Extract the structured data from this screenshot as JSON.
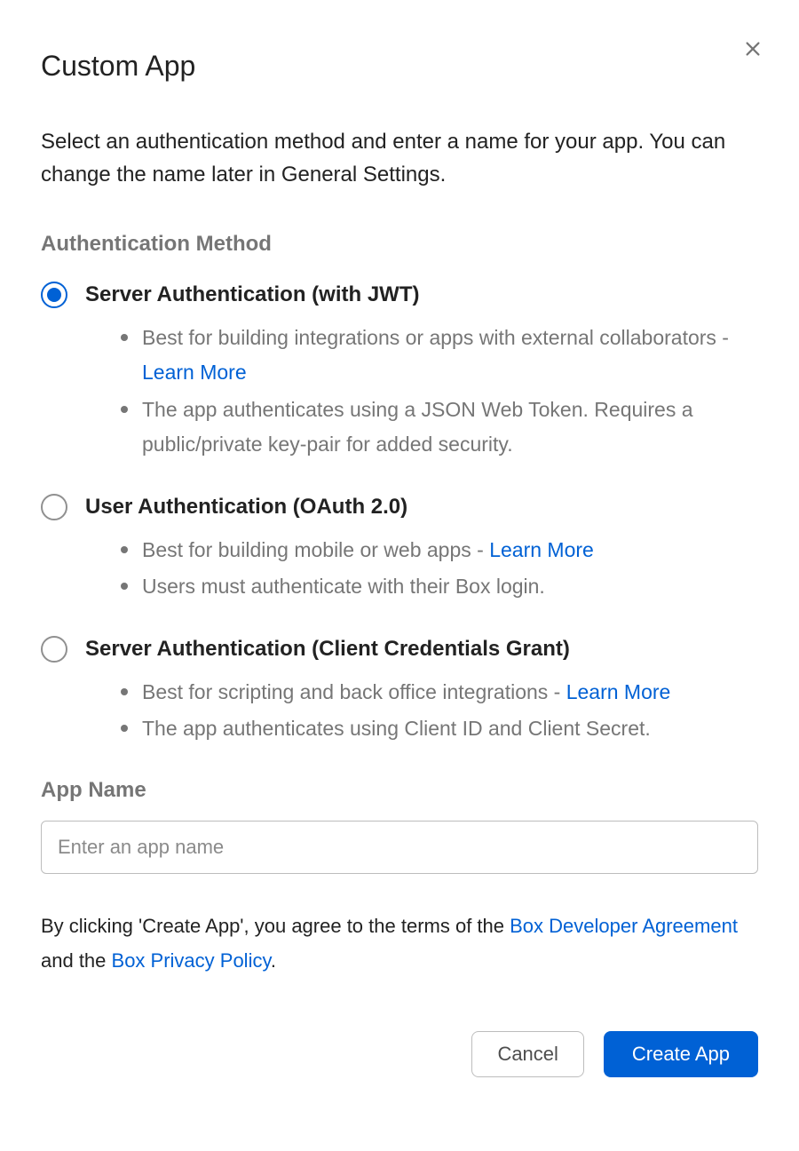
{
  "dialog": {
    "title": "Custom App",
    "subtitle": "Select an authentication method and enter a name for your app. You can change the name later in General Settings.",
    "close_icon": "close-icon"
  },
  "auth": {
    "section_label": "Authentication Method",
    "options": [
      {
        "label": "Server Authentication (with JWT)",
        "selected": true,
        "bullets": [
          {
            "text_before": "Best for building integrations or apps with external collaborators - ",
            "link": "Learn More",
            "text_after": ""
          },
          {
            "text_before": "The app authenticates using a JSON Web Token. Requires a public/private key-pair for added security.",
            "link": "",
            "text_after": ""
          }
        ]
      },
      {
        "label": "User Authentication (OAuth 2.0)",
        "selected": false,
        "bullets": [
          {
            "text_before": "Best for building mobile or web apps - ",
            "link": "Learn More",
            "text_after": ""
          },
          {
            "text_before": "Users must authenticate with their Box login.",
            "link": "",
            "text_after": ""
          }
        ]
      },
      {
        "label": "Server Authentication (Client Credentials Grant)",
        "selected": false,
        "bullets": [
          {
            "text_before": "Best for scripting and back office integrations - ",
            "link": "Learn More",
            "text_after": ""
          },
          {
            "text_before": "The app authenticates using Client ID and Client Secret.",
            "link": "",
            "text_after": ""
          }
        ]
      }
    ]
  },
  "app_name": {
    "section_label": "App Name",
    "placeholder": "Enter an app name",
    "value": ""
  },
  "terms": {
    "prefix": "By clicking 'Create App', you agree to the terms of the ",
    "link1": "Box Developer Agreement",
    "mid": " and the ",
    "link2": "Box Privacy Policy",
    "suffix": "."
  },
  "footer": {
    "cancel": "Cancel",
    "create": "Create App"
  }
}
